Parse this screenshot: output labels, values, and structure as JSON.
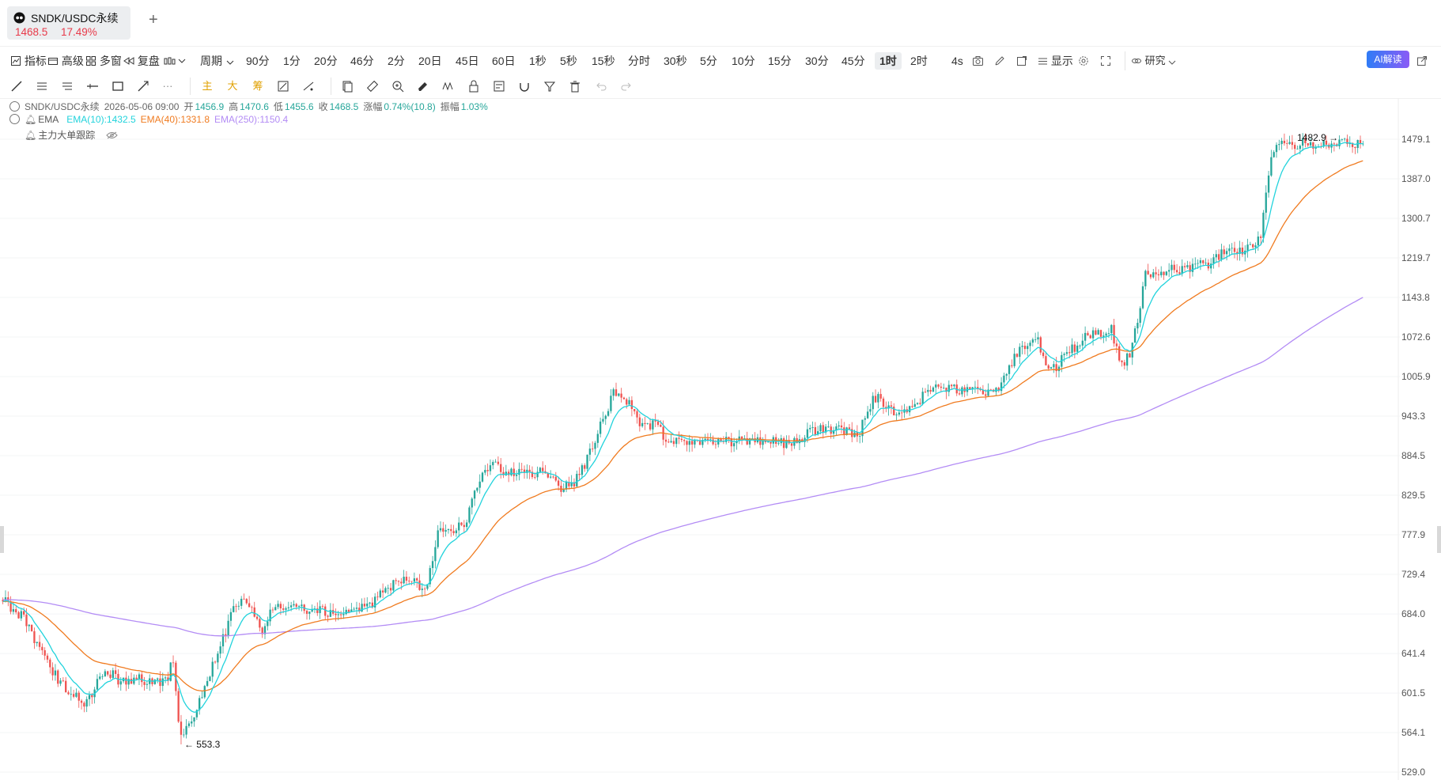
{
  "tab": {
    "title": "SNDK/USDC永续",
    "price": "1468.5",
    "change": "17.49%",
    "add_label": "+"
  },
  "toolbar": {
    "indicator": "指标",
    "advanced": "高级",
    "multi_window": "多窗",
    "replay": "复盘",
    "period": "周期",
    "intervals": [
      "90分",
      "1分",
      "20分",
      "46分",
      "2分",
      "20日",
      "45日",
      "60日",
      "1秒",
      "5秒",
      "15秒",
      "分时",
      "30秒",
      "5分",
      "10分",
      "15分",
      "30分",
      "45分",
      "1时",
      "2时"
    ],
    "active_interval": "1时",
    "countdown": "4s",
    "display": "显示",
    "research": "研究",
    "ai": "AI解读"
  },
  "drawbar": {
    "main": "主",
    "big": "大",
    "chip": "筹",
    "more": "···"
  },
  "legend": {
    "symbol": "SNDK/USDC永续",
    "datetime": "2026-05-06 09:00",
    "open_label": "开",
    "open": "1456.9",
    "high_label": "高",
    "high": "1470.6",
    "low_label": "低",
    "low": "1455.6",
    "close_label": "收",
    "close": "1468.5",
    "change_label": "涨幅",
    "change": "0.74%(10.8)",
    "amplitude_label": "振幅",
    "amplitude": "1.03%",
    "ema_name": "EMA",
    "ema10": "EMA(10):1432.5",
    "ema40": "EMA(40):1331.8",
    "ema250": "EMA(250):1150.4",
    "tracker": "主力大单跟踪"
  },
  "colors": {
    "up": "#26a69a",
    "down": "#ef5350",
    "ema10": "#22d3dc",
    "ema40": "#f07b20",
    "ema250": "#b38cf5",
    "accent_red": "#e83a4a"
  },
  "chart_data": {
    "type": "candlestick",
    "price_axis": [
      "1479.1",
      "1387.0",
      "1300.7",
      "1219.7",
      "1143.8",
      "1072.6",
      "1005.9",
      "943.3",
      "884.5",
      "829.5",
      "777.9",
      "729.4",
      "684.0",
      "641.4",
      "601.5",
      "564.1",
      "529.0"
    ],
    "ylim": [
      529.0,
      1479.1
    ],
    "y_scale": "log",
    "max_marker": "1482.9",
    "min_marker": "553.3",
    "max_value": 1482.9,
    "min_value": 553.3,
    "path_knots": [
      [
        0,
        700
      ],
      [
        0.015,
        680
      ],
      [
        0.04,
        615
      ],
      [
        0.06,
        590
      ],
      [
        0.075,
        625
      ],
      [
        0.085,
        615
      ],
      [
        0.1,
        615
      ],
      [
        0.12,
        612
      ],
      [
        0.125,
        635
      ],
      [
        0.13,
        560
      ],
      [
        0.14,
        575
      ],
      [
        0.15,
        615
      ],
      [
        0.16,
        650
      ],
      [
        0.17,
        690
      ],
      [
        0.18,
        700
      ],
      [
        0.19,
        665
      ],
      [
        0.2,
        695
      ],
      [
        0.22,
        690
      ],
      [
        0.24,
        685
      ],
      [
        0.26,
        690
      ],
      [
        0.27,
        695
      ],
      [
        0.29,
        720
      ],
      [
        0.3,
        725
      ],
      [
        0.31,
        705
      ],
      [
        0.32,
        780
      ],
      [
        0.34,
        790
      ],
      [
        0.35,
        850
      ],
      [
        0.36,
        880
      ],
      [
        0.37,
        860
      ],
      [
        0.4,
        860
      ],
      [
        0.41,
        840
      ],
      [
        0.42,
        845
      ],
      [
        0.43,
        880
      ],
      [
        0.45,
        985
      ],
      [
        0.46,
        965
      ],
      [
        0.47,
        930
      ],
      [
        0.48,
        930
      ],
      [
        0.49,
        905
      ],
      [
        0.5,
        905
      ],
      [
        0.52,
        910
      ],
      [
        0.53,
        905
      ],
      [
        0.55,
        905
      ],
      [
        0.57,
        905
      ],
      [
        0.58,
        900
      ],
      [
        0.59,
        915
      ],
      [
        0.6,
        925
      ],
      [
        0.62,
        920
      ],
      [
        0.63,
        920
      ],
      [
        0.64,
        975
      ],
      [
        0.66,
        945
      ],
      [
        0.67,
        955
      ],
      [
        0.68,
        990
      ],
      [
        0.7,
        985
      ],
      [
        0.72,
        985
      ],
      [
        0.73,
        980
      ],
      [
        0.74,
        1020
      ],
      [
        0.75,
        1060
      ],
      [
        0.76,
        1070
      ],
      [
        0.77,
        1010
      ],
      [
        0.78,
        1040
      ],
      [
        0.79,
        1060
      ],
      [
        0.8,
        1080
      ],
      [
        0.815,
        1085
      ],
      [
        0.82,
        1040
      ],
      [
        0.825,
        1030
      ],
      [
        0.83,
        1050
      ],
      [
        0.84,
        1185
      ],
      [
        0.85,
        1195
      ],
      [
        0.87,
        1200
      ],
      [
        0.88,
        1205
      ],
      [
        0.89,
        1210
      ],
      [
        0.9,
        1240
      ],
      [
        0.91,
        1235
      ],
      [
        0.92,
        1245
      ],
      [
        0.925,
        1270
      ],
      [
        0.93,
        1400
      ],
      [
        0.935,
        1450
      ],
      [
        0.94,
        1468.5
      ]
    ],
    "ema10_last": 1432.5,
    "ema40_last": 1331.8,
    "ema250_last": 1150.4
  }
}
